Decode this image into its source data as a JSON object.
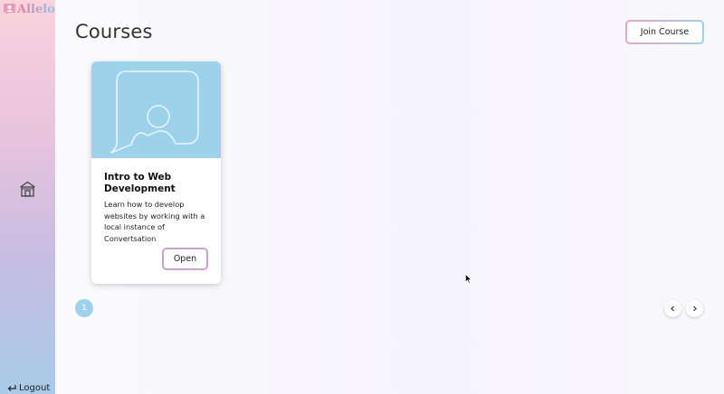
{
  "app": {
    "name": "Allelo"
  },
  "sidebar": {
    "logout_label": "Logout"
  },
  "header": {
    "title": "Courses",
    "join_course_label": "Join Course"
  },
  "courses": [
    {
      "title": "Intro to Web Development",
      "description": "Learn how to develop websites by working with a local instance of Convertsation",
      "open_label": "Open"
    }
  ],
  "pagination": {
    "current_page": "1"
  },
  "icons": {
    "logo": "allelo-logo-icon",
    "home": "home-icon",
    "logout": "logout-arrow-icon",
    "course_image": "user-placeholder-icon",
    "prev": "chevron-left-icon",
    "next": "chevron-right-icon"
  },
  "colors": {
    "accent_blue": "#9ed2ea",
    "accent_pink": "#e7a4c2",
    "button_border_purple": "#c6a2cd"
  }
}
